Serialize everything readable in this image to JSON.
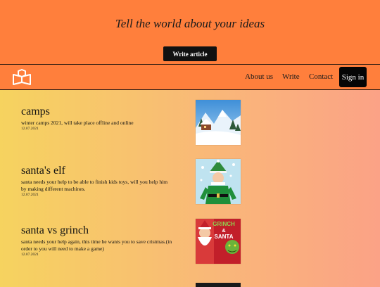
{
  "hero": {
    "title": "Tell the world about your ideas",
    "write_button": "Write article"
  },
  "nav": {
    "logo_icon": "open-book-icon",
    "links": [
      "About us",
      "Write",
      "Contact"
    ],
    "signin": "Sign in"
  },
  "posts": [
    {
      "title": "camps",
      "description": "winter camps 2021, will take place offline and online",
      "date": "12.07.2021",
      "image": "snowy-cabin-image"
    },
    {
      "title": "santa's elf",
      "description": "santa needs your help to be able to finish kids toys, will you help him by making different machines.",
      "date": "12.07.2021",
      "image": "elf-image"
    },
    {
      "title": "santa vs grinch",
      "description": "santa needs your help again, this time he wants you to save cristmas.(in order to you will need to make a game)",
      "date": "12.07.2021",
      "image": "grinch-santa-image",
      "image_text": [
        "GRINCH",
        "&",
        "SANTA"
      ]
    }
  ],
  "colors": {
    "header_bg": "#ff7f3c",
    "button_bg": "#111111",
    "gradient_left": "#f6d35f",
    "gradient_right": "#fba286"
  }
}
